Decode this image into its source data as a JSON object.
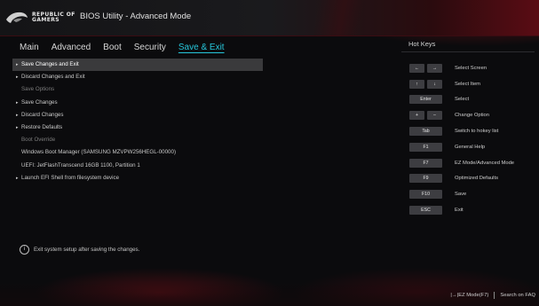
{
  "header": {
    "brand_line1": "REPUBLIC OF",
    "brand_line2": "GAMERS",
    "title": "BIOS Utility - Advanced Mode"
  },
  "tabs": [
    {
      "label": "Main",
      "active": false
    },
    {
      "label": "Advanced",
      "active": false
    },
    {
      "label": "Boot",
      "active": false
    },
    {
      "label": "Security",
      "active": false
    },
    {
      "label": "Save & Exit",
      "active": true
    }
  ],
  "menu": [
    {
      "label": "Save Changes and Exit",
      "type": "action",
      "selected": true
    },
    {
      "label": "Discard Changes and Exit",
      "type": "action"
    },
    {
      "label": "Save Options",
      "type": "section"
    },
    {
      "label": "Save Changes",
      "type": "action"
    },
    {
      "label": "Discard Changes",
      "type": "action"
    },
    {
      "label": "Restore Defaults",
      "type": "action"
    },
    {
      "label": "Boot Override",
      "type": "section"
    },
    {
      "label": "Windows Boot Manager (SAMSUNG MZVPW256HEGL-00000)",
      "type": "item"
    },
    {
      "label": "UEFI: JetFlashTranscend 16GB 1100, Partition 1",
      "type": "item"
    },
    {
      "label": "Launch EFI Shell from filesystem device",
      "type": "action"
    }
  ],
  "help_text": "Exit system setup after saving the changes.",
  "hotkeys": {
    "title": "Hot Keys",
    "rows": [
      {
        "keys": [
          "←",
          "→"
        ],
        "label": "Select Screen"
      },
      {
        "keys": [
          "↑",
          "↓"
        ],
        "label": "Select Item"
      },
      {
        "keys": [
          "Enter"
        ],
        "label": "Select"
      },
      {
        "keys": [
          "+",
          "–"
        ],
        "label": "Change Option"
      },
      {
        "keys": [
          "Tab"
        ],
        "label": "Switch to hokey list"
      },
      {
        "keys": [
          "F1"
        ],
        "label": "General Help"
      },
      {
        "keys": [
          "F7"
        ],
        "label": "EZ Mode/Advanced Mode"
      },
      {
        "keys": [
          "F9"
        ],
        "label": "Optimized Defaults"
      },
      {
        "keys": [
          "F10"
        ],
        "label": "Save"
      },
      {
        "keys": [
          "ESC"
        ],
        "label": "Exit"
      }
    ]
  },
  "footer": {
    "ez_mode": "|→|EZ Mode(F7)",
    "search": "Search on FAQ"
  },
  "colors": {
    "accent": "#26c6da",
    "brand_red": "#a8141e",
    "selected_row": "#3a3a3c"
  }
}
